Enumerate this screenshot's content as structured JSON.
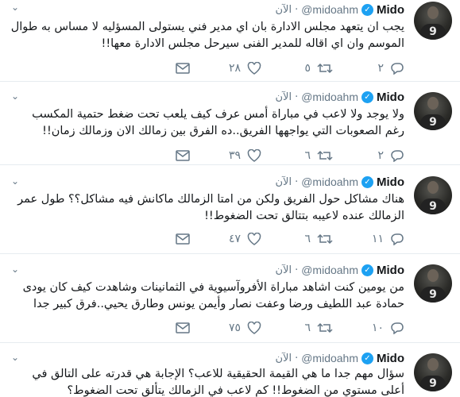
{
  "user": {
    "name": "Mido",
    "handle": "@midoahm",
    "handle_alt": "@midoahm",
    "avatar_number": "9",
    "verified_mark": "✓"
  },
  "tweets": [
    {
      "handle": "@midoahm",
      "time": "الآن",
      "text": "يجب ان يتعهد مجلس الادارة بان اي مدير فني يستولى المسؤليه لا مساس به طوال الموسم وان اي اقاله للمدير الفنى سيرحل مجلس الادارة معها!!",
      "replies": "٢",
      "retweets": "",
      "likes": "٢٨",
      "retweets_val": "٥"
    },
    {
      "handle": "@midoahm",
      "time": "الآن",
      "text": "ولا يوجد ولا لاعب في مباراة أمس عرف كيف يلعب تحت ضغط حتمية المكسب رغم الصعوبات التي يواجهها الفريق..ده الفرق بين زمالك الان وزمالك زمان!!",
      "replies": "٢",
      "retweets_val": "٦",
      "likes": "٣٩"
    },
    {
      "handle": "@midoahm",
      "time": "الآن",
      "text": "هناك مشاكل حول الفريق ولكن من امتا الزمالك ماكانش فيه مشاكل؟؟ طول عمر الزمالك عنده لاعيبه بتتالق تحت الضغوط!!",
      "replies": "١١",
      "retweets_val": "٦",
      "likes": "٤٧"
    },
    {
      "handle": "@midoahm",
      "time": "الآن",
      "text": "من يومين كنت اشاهد مباراة الأفروآسيوية في الثمانينات وشاهدت كيف كان يودى حمادة عبد اللطيف ورضا وعفت نصار وأيمن يونس وطارق يحيي..فرق كبير جدا",
      "replies": "١٠",
      "retweets_val": "٦",
      "likes": "٧٥"
    },
    {
      "handle": "@midoahm",
      "time": "الآن",
      "text": "سؤال مهم جدا ما هي القيمة الحقيقية للاعب؟ الإجابة هي قدرته على التالق في أعلى مستوي من الضغوط!! كم لاعب في الزمالك يتألق تحت الضغوط؟",
      "replies": "",
      "retweets_val": "",
      "likes": ""
    }
  ],
  "icons": {
    "reply": "reply-icon",
    "retweet": "retweet-icon",
    "like": "heart-icon",
    "dm": "envelope-icon",
    "caret": "chevron-down-icon"
  },
  "colors": {
    "accent": "#1da1f2",
    "muted": "#657786",
    "divider": "#e6ecf0"
  }
}
